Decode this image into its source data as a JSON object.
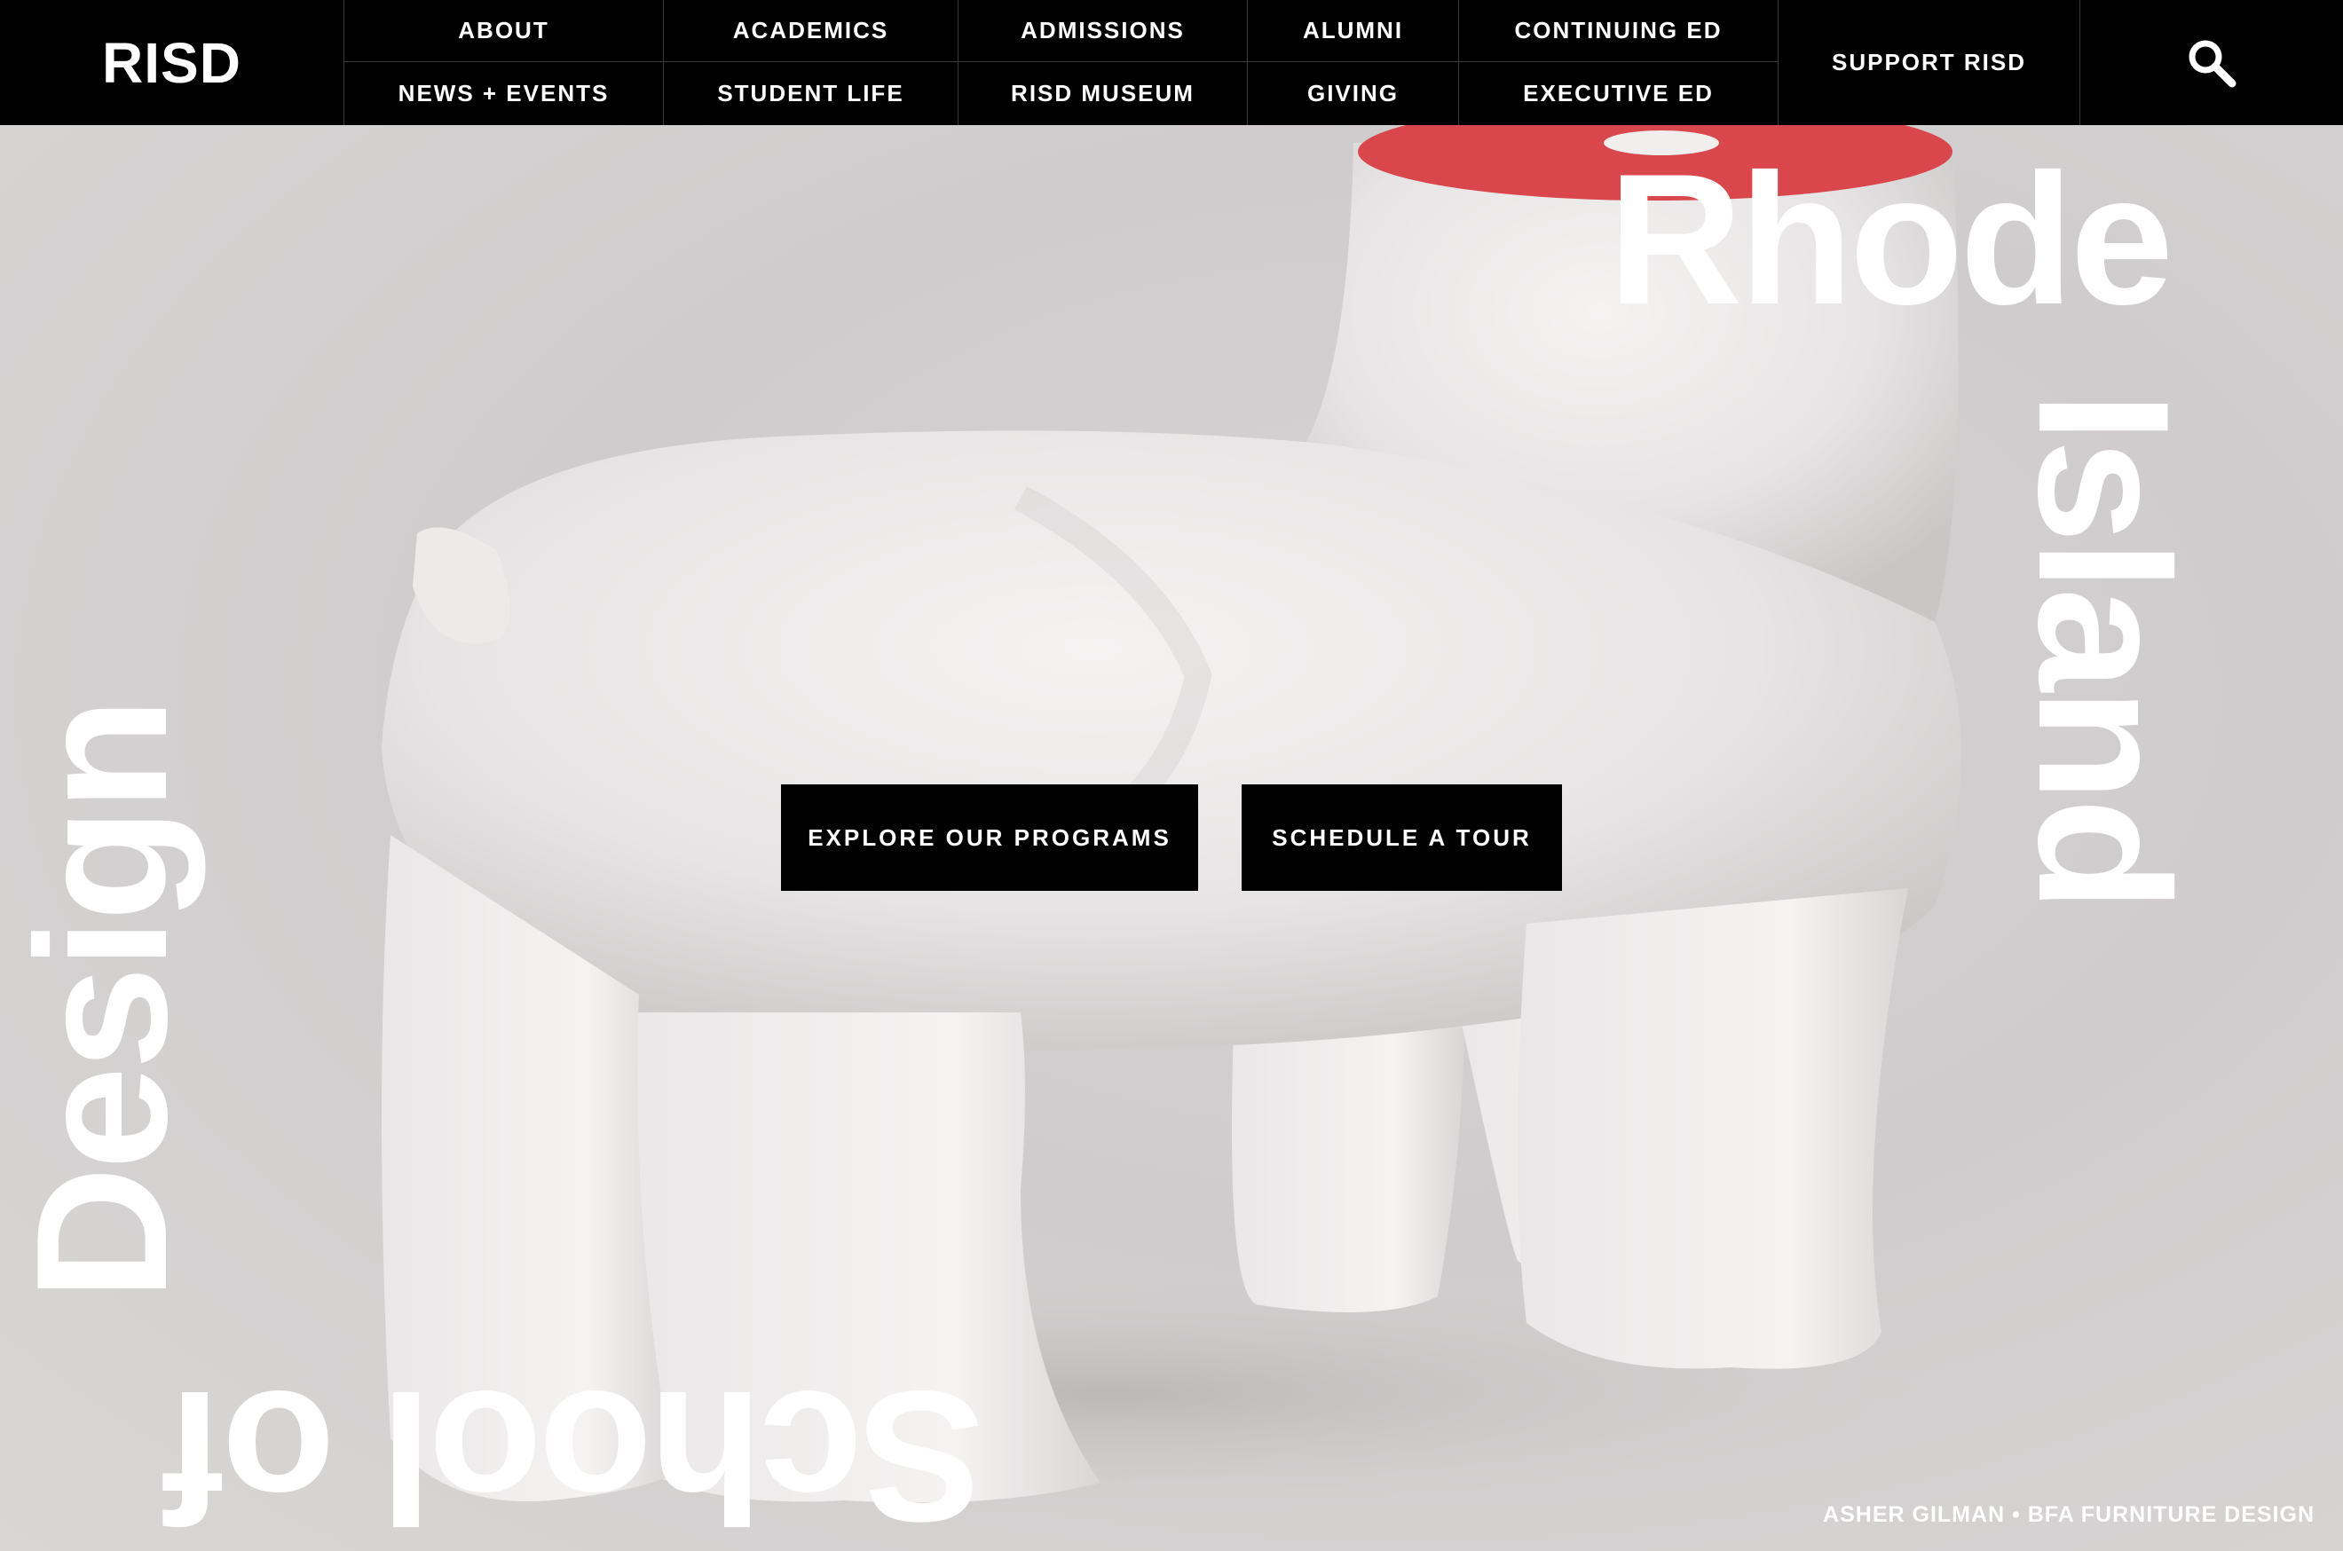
{
  "header": {
    "logo": "RISD",
    "nav_row1": [
      "ABOUT",
      "ACADEMICS",
      "ADMISSIONS",
      "ALUMNI",
      "CONTINUING ED"
    ],
    "nav_row2": [
      "NEWS + EVENTS",
      "STUDENT LIFE",
      "RISD MUSEUM",
      "GIVING",
      "EXECUTIVE ED"
    ],
    "support": "SUPPORT RISD",
    "search_icon": "search-icon"
  },
  "hero": {
    "words": {
      "rhode": "Rhode",
      "island": "Island",
      "design": "Design",
      "school_of": "School of"
    },
    "cta_primary": "EXPLORE OUR PROGRAMS",
    "cta_secondary": "SCHEDULE A TOUR",
    "caption": "ASHER GILMAN • BFA FURNITURE DESIGN"
  },
  "colors": {
    "nav_bg": "#000000",
    "text": "#ffffff",
    "accent_red": "#d9474c"
  }
}
